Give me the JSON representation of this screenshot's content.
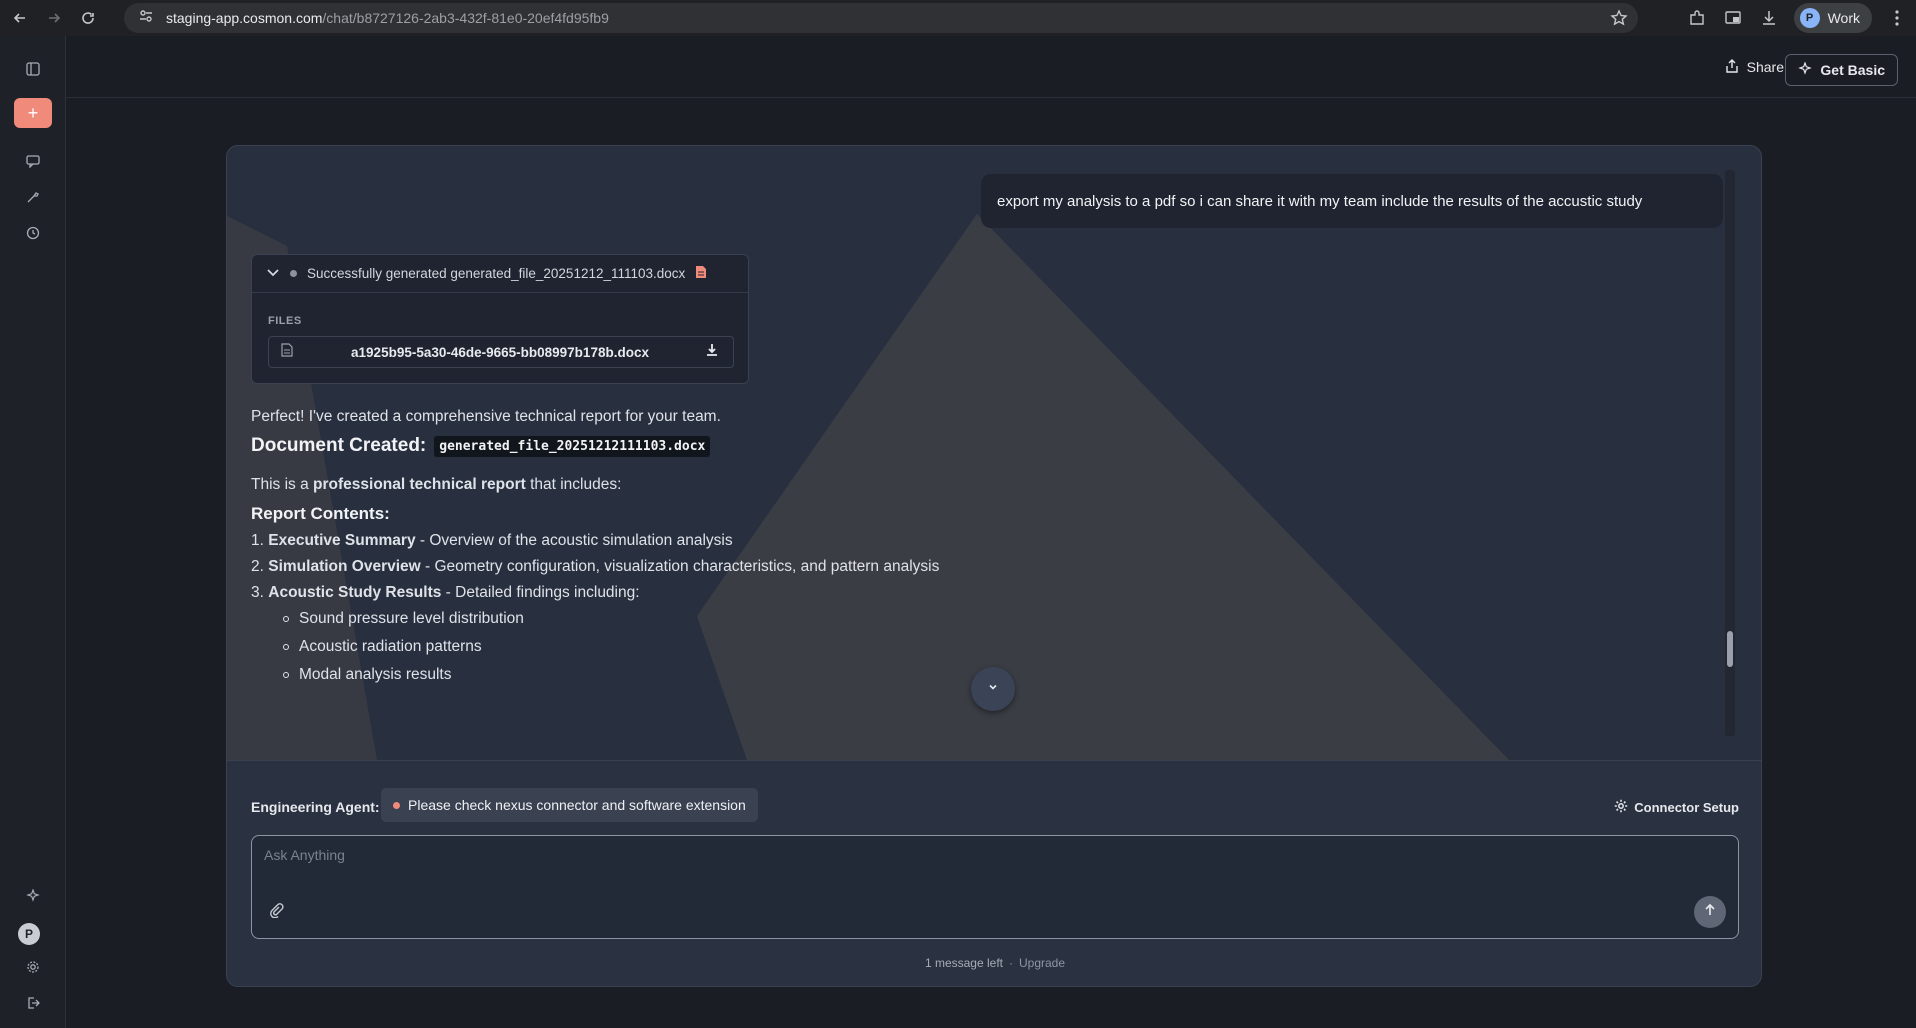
{
  "browser": {
    "url_host": "staging-app.cosmon.com",
    "url_path": "/chat/b8727126-2ab3-432f-81e0-20ef4fd95fb9",
    "profile_initial": "P",
    "profile_label": "Work"
  },
  "header": {
    "share_label": "Share",
    "get_basic_label": "Get Basic"
  },
  "chat": {
    "user_message": "export my analysis to a pdf so i can share it with my team include the results of the accustic study",
    "file_card": {
      "status_text": "Successfully generated generated_file_20251212_111103.docx",
      "files_label": "FILES",
      "file_name": "a1925b95-5a30-46de-9665-bb08997b178b.docx"
    },
    "assistant": {
      "intro": "Perfect! I've created a comprehensive technical report for your team.",
      "doc_created_label": "Document Created:",
      "doc_file_code": "generated_file_20251212111103.docx",
      "desc_prefix": "This is a ",
      "desc_bold": "professional technical report",
      "desc_suffix": " that includes:",
      "report_heading": "Report Contents:",
      "items": [
        {
          "num": "1.",
          "title": "Executive Summary",
          "desc": " - Overview of the acoustic simulation analysis"
        },
        {
          "num": "2.",
          "title": "Simulation Overview",
          "desc": " - Geometry configuration, visualization characteristics, and pattern analysis"
        },
        {
          "num": "3.",
          "title": "Acoustic Study Results",
          "desc": " - Detailed findings including:"
        }
      ],
      "bullets": [
        "Sound pressure level distribution",
        "Acoustic radiation patterns",
        "Modal analysis results"
      ]
    }
  },
  "composer": {
    "agent_label": "Engineering Agent:",
    "agent_status": "Please check nexus connector and software extension",
    "connector_label": "Connector Setup",
    "placeholder": "Ask Anything",
    "value": "",
    "quota_text": "1 message left",
    "quota_sep": "·",
    "upgrade_label": "Upgrade"
  },
  "colors": {
    "accent": "#f08a7b",
    "panel_bg": "#283040",
    "page_bg": "#1a1d24"
  }
}
